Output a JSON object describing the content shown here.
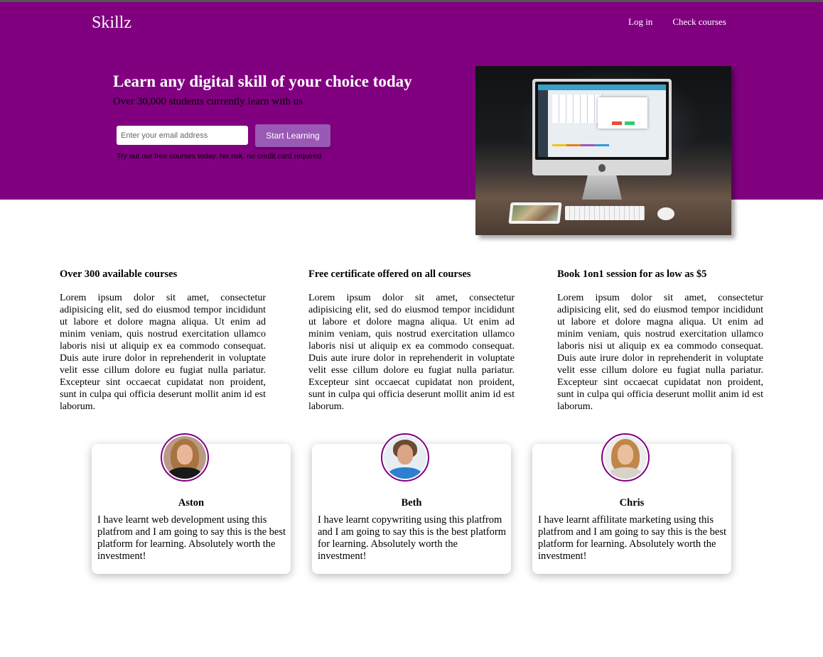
{
  "header": {
    "logo": "Skillz",
    "nav": [
      {
        "label": "Log in"
      },
      {
        "label": "Check courses"
      }
    ]
  },
  "hero": {
    "title": "Learn any digital skill of your choice today",
    "subtitle": "Over 30,000 students currently learn with us",
    "email_placeholder": "Enter your email address",
    "cta_label": "Start Learning",
    "fine_print": "Try out our free courses today. No risk, no credit card required",
    "image": "imac-desk-photo"
  },
  "features": [
    {
      "title": "Over 300 available courses",
      "body": "Lorem ipsum dolor sit amet, consectetur adipisicing elit, sed do eiusmod tempor incididunt ut labore et dolore magna aliqua. Ut enim ad minim veniam, quis nostrud exercitation ullamco laboris nisi ut aliquip ex ea commodo consequat. Duis aute irure dolor in reprehenderit in voluptate velit esse cillum dolore eu fugiat nulla pariatur. Excepteur sint occaecat cupidatat non proident, sunt in culpa qui officia deserunt mollit anim id est laborum."
    },
    {
      "title": "Free certificate offered on all courses",
      "body": "Lorem ipsum dolor sit amet, consectetur adipisicing elit, sed do eiusmod tempor incididunt ut labore et dolore magna aliqua. Ut enim ad minim veniam, quis nostrud exercitation ullamco laboris nisi ut aliquip ex ea commodo consequat. Duis aute irure dolor in reprehenderit in voluptate velit esse cillum dolore eu fugiat nulla pariatur. Excepteur sint occaecat cupidatat non proident, sunt in culpa qui officia deserunt mollit anim id est laborum."
    },
    {
      "title": "Book 1on1 session for as low as $5",
      "body": "Lorem ipsum dolor sit amet, consectetur adipisicing elit, sed do eiusmod tempor incididunt ut labore et dolore magna aliqua. Ut enim ad minim veniam, quis nostrud exercitation ullamco laboris nisi ut aliquip ex ea commodo consequat. Duis aute irure dolor in reprehenderit in voluptate velit esse cillum dolore eu fugiat nulla pariatur. Excepteur sint occaecat cupidatat non proident, sunt in culpa qui officia deserunt mollit anim id est laborum."
    }
  ],
  "testimonials": [
    {
      "name": "Aston",
      "quote": "I have learnt web development using this platfrom and I am going to say this is the best platform for learning. Absolutely worth the investment!"
    },
    {
      "name": "Beth",
      "quote": "I have learnt copywriting using this platfrom and I am going to say this is the best platform for learning. Absolutely worth the investment!"
    },
    {
      "name": "Chris",
      "quote": "I have learnt affilitate marketing using this platfrom and I am going to say this is the best platform for learning. Absolutely worth the investment!"
    }
  ],
  "colors": {
    "brand": "#800080",
    "button": "#9b59b6",
    "text": "#000000",
    "white": "#ffffff"
  }
}
